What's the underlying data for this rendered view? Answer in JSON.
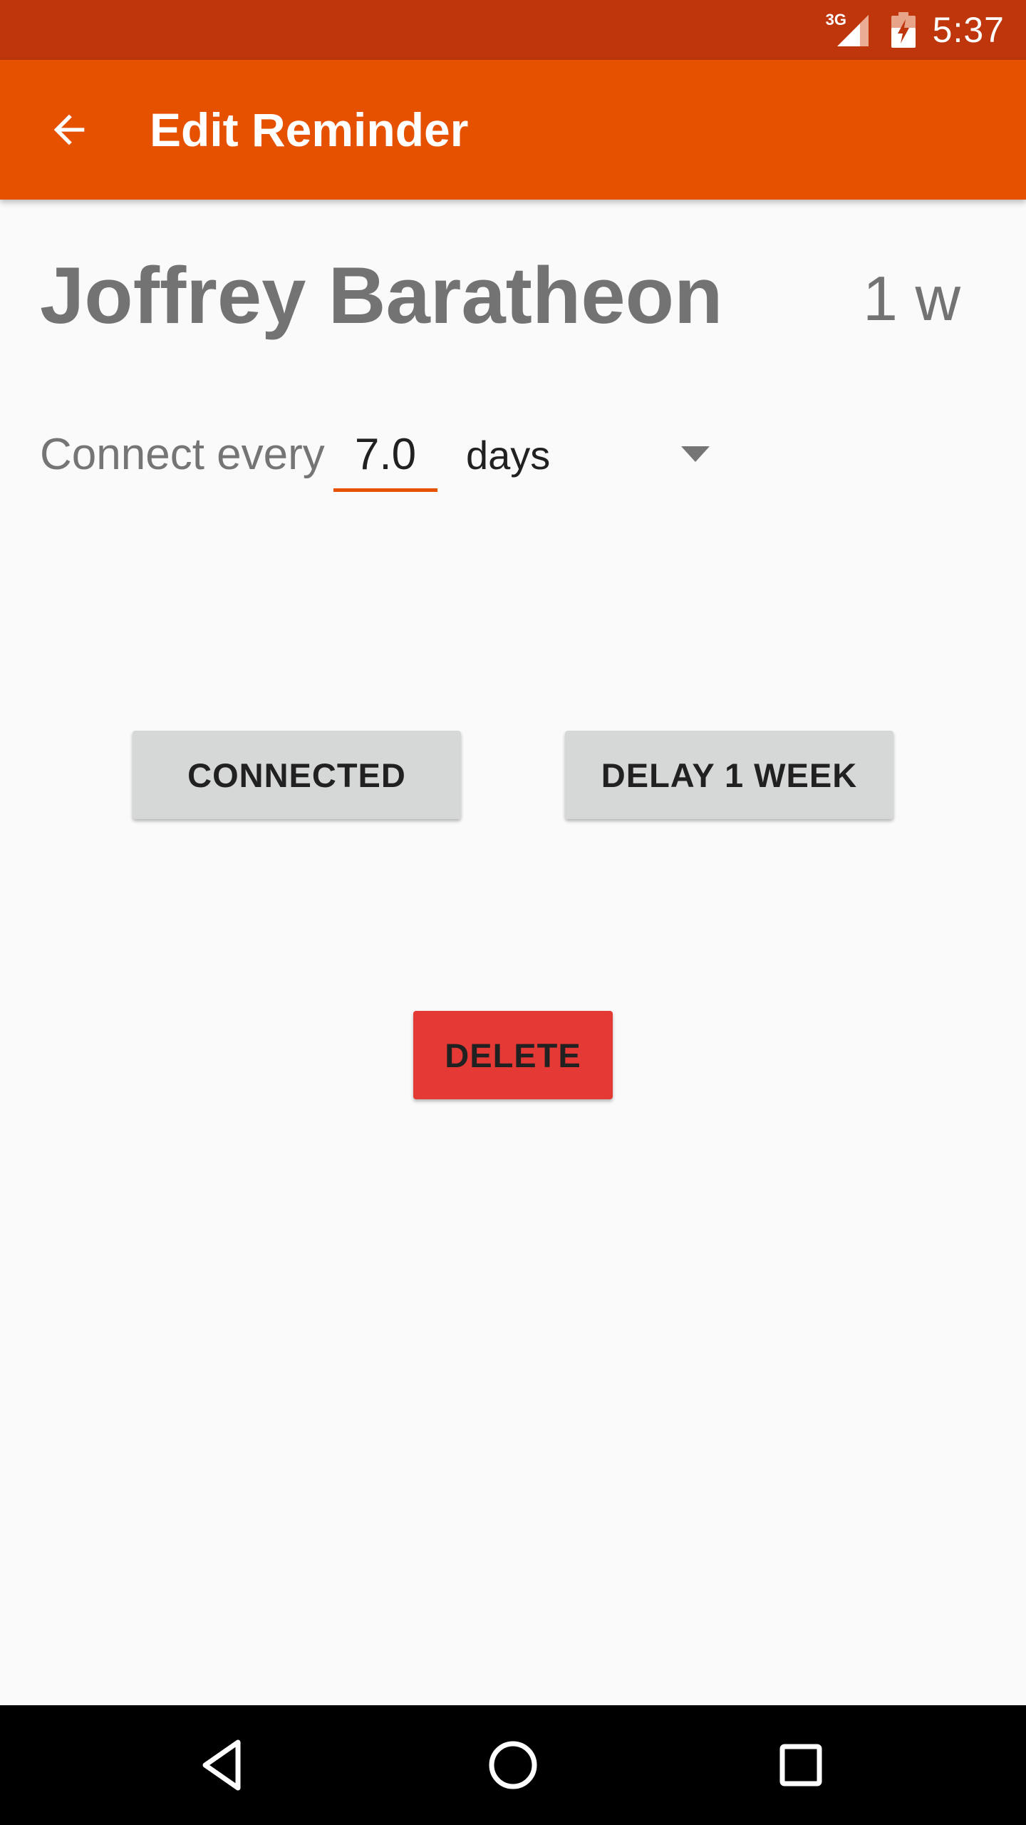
{
  "status_bar": {
    "network_label": "3G",
    "time": "5:37",
    "icons": [
      "signal-icon",
      "battery-charging-icon"
    ],
    "background_color": "#bf360c"
  },
  "app_bar": {
    "title": "Edit Reminder",
    "back_icon": "arrow-back-icon",
    "background_color": "#e65100"
  },
  "contact": {
    "name": "Joffrey Baratheon",
    "elapsed": "1 w"
  },
  "interval": {
    "label": "Connect every",
    "value": "7.0",
    "unit_selected": "days",
    "accent_color": "#e65100"
  },
  "actions": {
    "connected_label": "CONNECTED",
    "delay_label": "DELAY 1 WEEK",
    "delete_label": "DELETE",
    "delete_color": "#e53935"
  },
  "nav_bar": {
    "icons": [
      "nav-back-icon",
      "nav-home-icon",
      "nav-recents-icon"
    ]
  }
}
